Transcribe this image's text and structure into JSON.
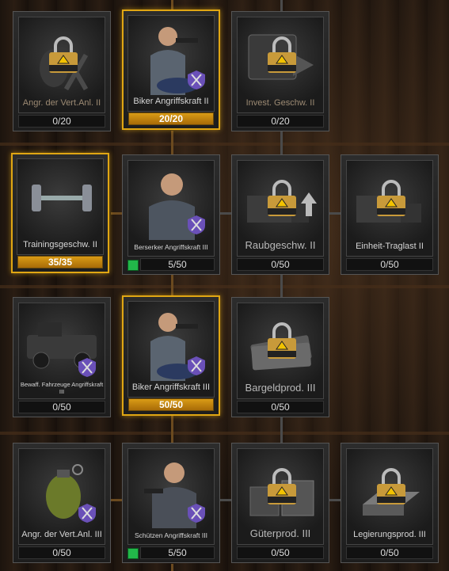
{
  "nodes": [
    {
      "label": "Angr. der Vert.Anl. II",
      "progress": "0/20",
      "locked": true,
      "gold": false
    },
    {
      "label": "Biker Angriffskraft II",
      "progress": "20/20",
      "locked": false,
      "gold": true
    },
    {
      "label": "Invest. Geschw. II",
      "progress": "0/20",
      "locked": true,
      "gold": false
    },
    {
      "label": "Trainingsgeschw. II",
      "progress": "35/35",
      "locked": false,
      "gold": true
    },
    {
      "label": "Berserker Angriffskraft III",
      "progress": "5/50",
      "locked": false,
      "gold": false
    },
    {
      "label": "Raubgeschw. II",
      "progress": "0/50",
      "locked": true,
      "gold": false
    },
    {
      "label": "Einheit-Traglast II",
      "progress": "0/50",
      "locked": true,
      "gold": false
    },
    {
      "label": "Bewaff. Fahrzeuge Angriffskraft III",
      "progress": "0/50",
      "locked": false,
      "gold": false
    },
    {
      "label": "Biker Angriffskraft III",
      "progress": "50/50",
      "locked": false,
      "gold": true
    },
    {
      "label": "Bargeldprod. III",
      "progress": "0/50",
      "locked": true,
      "gold": false
    },
    {
      "label": "Angr. der Vert.Anl. III",
      "progress": "0/50",
      "locked": false,
      "gold": false
    },
    {
      "label": "Schützen Angriffskraft III",
      "progress": "5/50",
      "locked": false,
      "gold": false
    },
    {
      "label": "Güterprod. III",
      "progress": "0/50",
      "locked": true,
      "gold": false
    },
    {
      "label": "Legierungsprod. III",
      "progress": "0/50",
      "locked": true,
      "gold": false
    }
  ],
  "icons": {
    "lock": "padlock-icon",
    "badge": "crossed-swords-icon",
    "progress_indicator": "green-square-icon"
  },
  "colors": {
    "gold": "#e0a613",
    "progress_fill": "#c4860f",
    "green": "#22b84a",
    "panel": "#242424"
  }
}
